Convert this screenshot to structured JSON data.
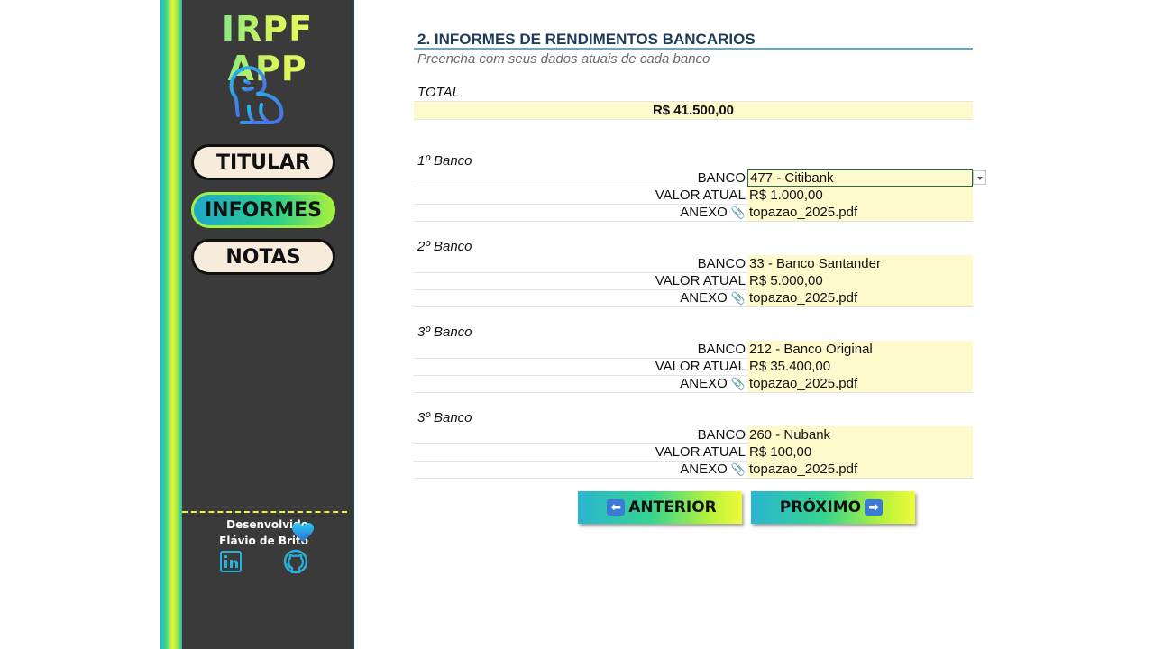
{
  "sidebar": {
    "app_title": "IRPF APP",
    "nav": [
      {
        "label": "TITULAR",
        "active": false
      },
      {
        "label": "INFORMES",
        "active": true
      },
      {
        "label": "NOTAS",
        "active": false
      }
    ],
    "credit_line1": "Desenvolvido",
    "credit_line2": "Flávio de Brito",
    "icons": [
      "lion-logo-icon",
      "heart-icon",
      "linkedin-icon",
      "github-icon"
    ]
  },
  "main": {
    "title": "2. INFORMES DE RENDIMENTOS BANCARIOS",
    "subtitle": "Preencha com seus dados atuais de cada banco",
    "total_label": "TOTAL",
    "total_value": "R$ 41.500,00",
    "field_labels": {
      "bank": "BANCO",
      "value": "VALOR ATUAL",
      "attachment": "ANEXO"
    },
    "banks": [
      {
        "heading": "1º Banco",
        "bank": "477 - Citibank",
        "value": "R$ 1.000,00",
        "attachment": "topazao_2025.pdf"
      },
      {
        "heading": "2º Banco",
        "bank": "33 - Banco Santander",
        "value": "R$ 5.000,00",
        "attachment": "topazao_2025.pdf"
      },
      {
        "heading": "3º Banco",
        "bank": "212 - Banco Original",
        "value": "R$ 35.400,00",
        "attachment": "topazao_2025.pdf"
      },
      {
        "heading": "3º Banco",
        "bank": "260 - Nubank",
        "value": "R$ 100,00",
        "attachment": "topazao_2025.pdf"
      }
    ],
    "prev_label": "ANTERIOR",
    "next_label": "PRÓXIMO"
  },
  "colors": {
    "accent_gradient_start": "#2ab5d2",
    "accent_gradient_end": "#f0fa3a",
    "sidebar_bg": "#3a3a3a",
    "input_bg": "#fffacc",
    "title": "#1f3b5a"
  }
}
